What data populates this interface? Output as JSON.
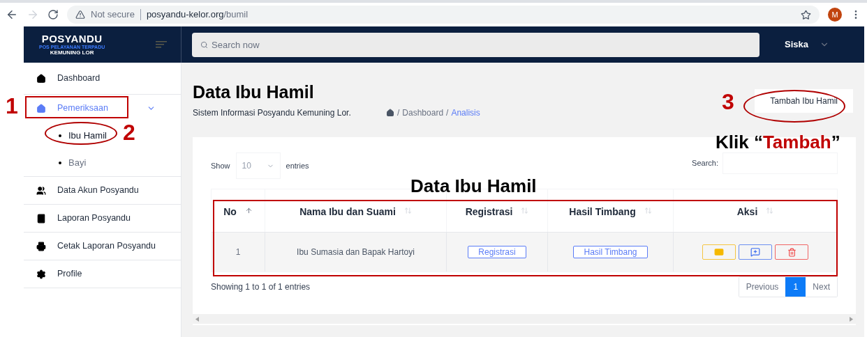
{
  "browser": {
    "security": "Not secure",
    "url_host": "posyandu-kelor.org",
    "url_path": "/bumil",
    "profile_initial": "M"
  },
  "header": {
    "logo_title": "POSYANDU",
    "logo_subtitle": "POS PELAYANAN TERPADU",
    "logo_place": "KEMUNING LOR",
    "search_placeholder": "Search now",
    "user": "Siska"
  },
  "sidebar": {
    "items": [
      {
        "label": "Dashboard",
        "selected": false
      },
      {
        "label": "Pemeriksaan",
        "selected": true,
        "expanded": true,
        "children": [
          {
            "label": "Ibu Hamil",
            "selected": true
          },
          {
            "label": "Bayi",
            "selected": false
          }
        ]
      },
      {
        "label": "Data Akun Posyandu",
        "selected": false
      },
      {
        "label": "Laporan Posyandu",
        "selected": false
      },
      {
        "label": "Cetak Laporan Posyandu",
        "selected": false
      },
      {
        "label": "Profile",
        "selected": false
      }
    ]
  },
  "page": {
    "title": "Data Ibu Hamil",
    "subtitle": "Sistem Informasi Posyandu Kemuning Lor.",
    "breadcrumb_separator": "/",
    "breadcrumb": [
      {
        "label": "Dashboard",
        "selected": false
      },
      {
        "label": "Analisis",
        "selected": true
      }
    ],
    "add_button": "Tambah Ibu Hamil"
  },
  "table_controls": {
    "show_label": "Show",
    "page_size": "10",
    "entries_label": "entries",
    "search_label": "Search:"
  },
  "table": {
    "columns": [
      "No",
      "Nama Ibu dan Suami",
      "Registrasi",
      "Hasil Timbang",
      "Aksi"
    ],
    "rows": [
      {
        "no": "1",
        "name": "Ibu Sumasia dan Bapak Hartoyi",
        "registrasi": "Registrasi",
        "hasil_timbang": "Hasil Timbang"
      }
    ]
  },
  "footer": {
    "info": "Showing 1 to 1 of 1 entries",
    "previous": "Previous",
    "pages": [
      {
        "label": "1",
        "selected": true
      }
    ],
    "next": "Next"
  },
  "annotations": {
    "step_numbers": [
      "1",
      "2",
      "3"
    ],
    "table_caption": "Data Ibu Hamil",
    "instruction": {
      "before": "Klik “",
      "highlight": "Tambah",
      "after": "”"
    }
  }
}
